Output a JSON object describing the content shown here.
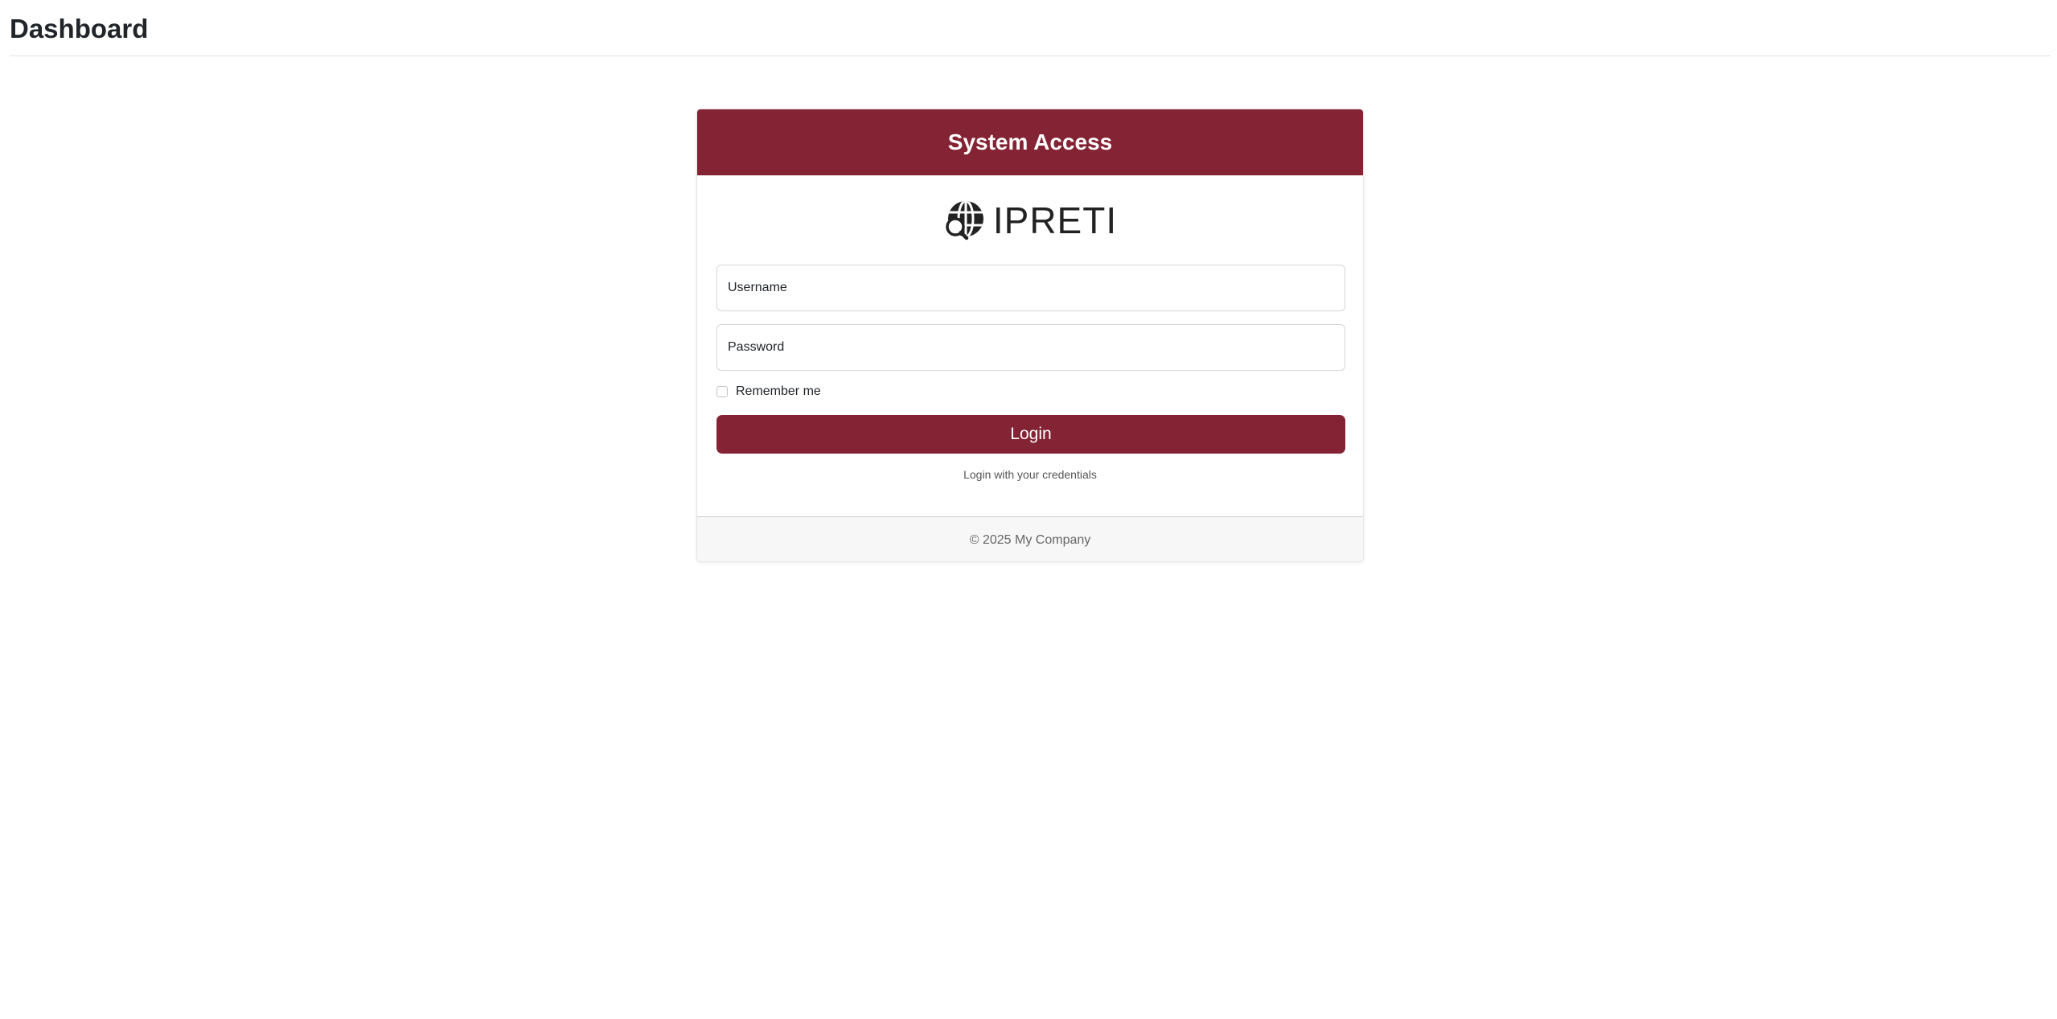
{
  "page": {
    "title": "Dashboard"
  },
  "card": {
    "title": "System Access",
    "logo": {
      "icon": "globe-search-icon",
      "text": "IPRETI"
    },
    "username": {
      "placeholder": "Username",
      "value": ""
    },
    "password": {
      "placeholder": "Password",
      "value": ""
    },
    "remember_me": {
      "label": "Remember me",
      "checked": false
    },
    "login_button_label": "Login",
    "help_text": "Login with your credentials",
    "footer_text": "© 2025 My Company"
  },
  "colors": {
    "accent": "#842334",
    "footer_bg": "#f7f7f7"
  }
}
